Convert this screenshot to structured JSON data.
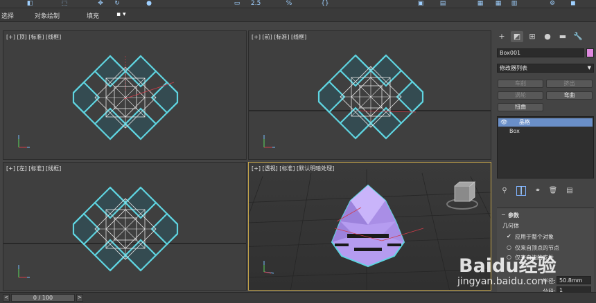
{
  "ribbon": {
    "items": [
      "选择",
      "对象绘制",
      "填充"
    ]
  },
  "viewports": {
    "top": "[+] [顶] [标准] [线框]",
    "front": "[+] [前] [标准] [线框]",
    "left": "[+] [左] [标准] [线框]",
    "perspective": "[+] [透视] [标准] [默认明暗处理]"
  },
  "command_panel": {
    "object_name": "Box001",
    "object_color": "#e08ae0",
    "modifier_list": "修改器列表",
    "buttons": [
      "车削",
      "挤出",
      "涡轮",
      "弯曲",
      "扭曲"
    ],
    "stack": [
      "晶格",
      "Box"
    ],
    "params": {
      "rollout_title": "参数",
      "geometry_group": "几何体",
      "apply_whole": "应用于整个对象",
      "opt_vertices": "仅来自顶点的节点",
      "opt_struts": "仅来自边的支柱",
      "radius_label": "半径:",
      "radius_value": "50.8mm",
      "segments_label": "分段:",
      "segments_value": "1"
    }
  },
  "status": {
    "frame": "0 / 100",
    "prev": "<",
    "next": ">"
  },
  "watermark": {
    "main": "Baidu经验",
    "sub": "jingyan.baidu.com"
  }
}
